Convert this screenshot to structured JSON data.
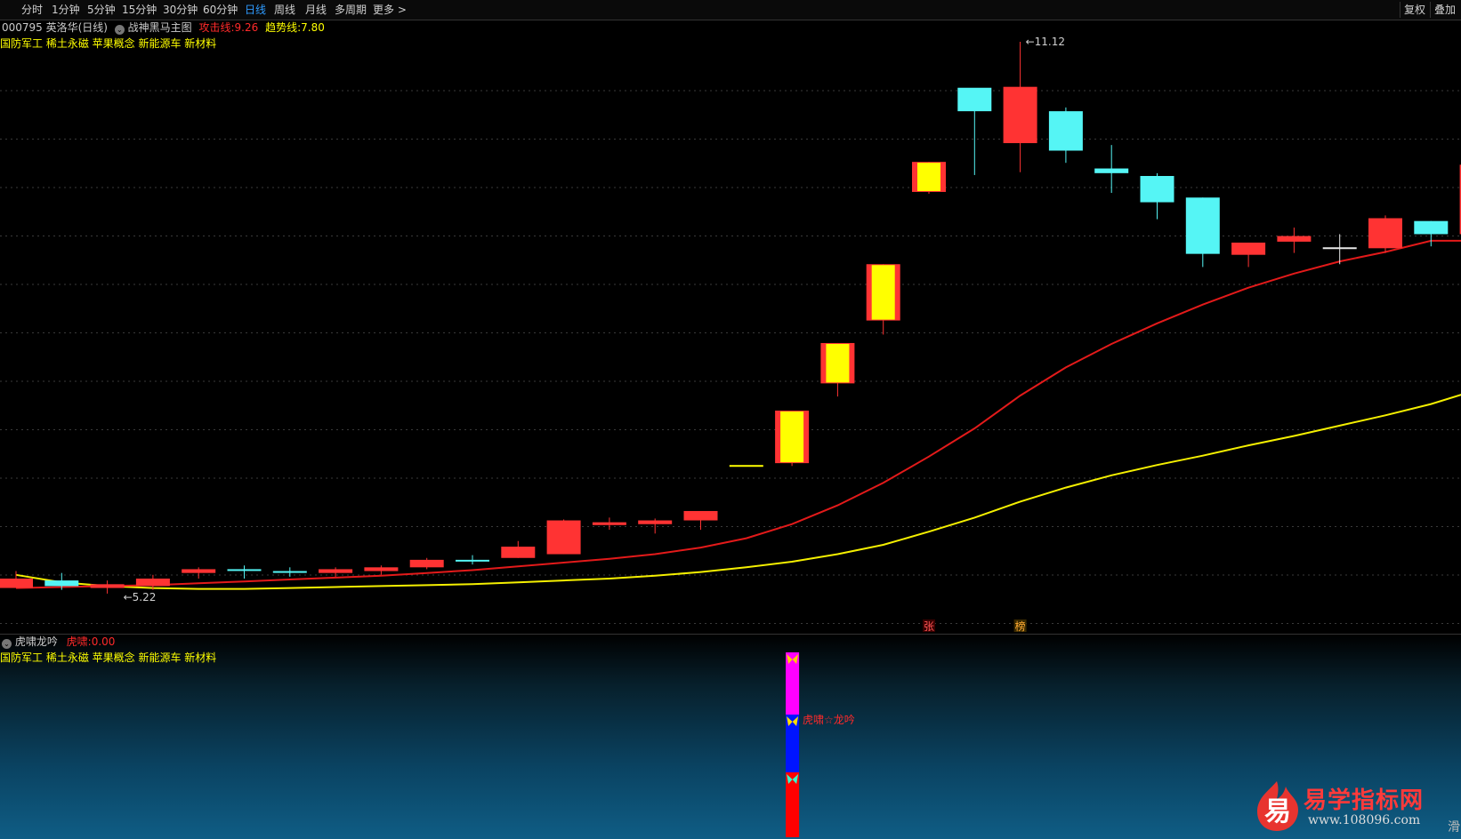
{
  "toolbar": {
    "timeframes": [
      "分时",
      "1分钟",
      "5分钟",
      "15分钟",
      "30分钟",
      "60分钟",
      "日线",
      "周线",
      "月线",
      "多周期",
      "更多 >"
    ],
    "active": "日线",
    "right": [
      "复权",
      "叠加"
    ]
  },
  "main_panel": {
    "stock_label": "000795 英洛华(日线)",
    "indicator_name": "战神黑马主图",
    "attack_label": "攻击线:",
    "attack_value": "9.26",
    "trend_label": "趋势线:",
    "trend_value": "7.80",
    "concepts": "国防军工 稀土永磁 苹果概念 新能源车 新材料",
    "high_label": "11.12",
    "low_label": "5.22",
    "marker_zhang": "张",
    "marker_bang": "榜"
  },
  "sub_panel": {
    "indicator_name": "虎啸龙吟",
    "value_label": "虎啸:",
    "value": "0.00",
    "concepts": "国防军工 稀土永磁 苹果概念 新能源车 新材料",
    "signal_text": "虎啸☆龙吟"
  },
  "watermark": {
    "logo_char": "易",
    "name": "易学指标网",
    "url": "www.108096.com",
    "edge_char": "滑"
  },
  "colors": {
    "up": "#ff3333",
    "down": "#55f5f5",
    "highlight": "#ffff00",
    "attack_line": "#e31a1a",
    "trend_line": "#f5f000",
    "active_tab": "#2e9bff"
  },
  "chart_data": {
    "type": "candlestick",
    "price_range": [
      5.0,
      11.4
    ],
    "high": 11.12,
    "low": 5.22,
    "candles": [
      {
        "o": 5.4,
        "h": 5.48,
        "l": 5.3,
        "c": 5.3,
        "style": "up"
      },
      {
        "o": 5.38,
        "h": 5.46,
        "l": 5.28,
        "c": 5.32,
        "style": "down"
      },
      {
        "o": 5.3,
        "h": 5.38,
        "l": 5.24,
        "c": 5.34,
        "style": "up"
      },
      {
        "o": 5.32,
        "h": 5.44,
        "l": 5.28,
        "c": 5.4,
        "style": "up"
      },
      {
        "o": 5.46,
        "h": 5.52,
        "l": 5.4,
        "c": 5.5,
        "style": "up"
      },
      {
        "o": 5.5,
        "h": 5.54,
        "l": 5.4,
        "c": 5.49,
        "style": "down"
      },
      {
        "o": 5.48,
        "h": 5.52,
        "l": 5.42,
        "c": 5.47,
        "style": "down"
      },
      {
        "o": 5.46,
        "h": 5.52,
        "l": 5.42,
        "c": 5.5,
        "style": "up"
      },
      {
        "o": 5.48,
        "h": 5.54,
        "l": 5.44,
        "c": 5.52,
        "style": "up"
      },
      {
        "o": 5.52,
        "h": 5.62,
        "l": 5.5,
        "c": 5.6,
        "style": "up"
      },
      {
        "o": 5.6,
        "h": 5.65,
        "l": 5.55,
        "c": 5.59,
        "style": "down"
      },
      {
        "o": 5.62,
        "h": 5.8,
        "l": 5.62,
        "c": 5.74,
        "style": "up"
      },
      {
        "o": 5.66,
        "h": 6.03,
        "l": 5.66,
        "c": 6.02,
        "style": "up"
      },
      {
        "o": 5.97,
        "h": 6.05,
        "l": 5.92,
        "c": 6.0,
        "style": "up"
      },
      {
        "o": 5.98,
        "h": 6.04,
        "l": 5.88,
        "c": 6.02,
        "style": "up"
      },
      {
        "o": 6.02,
        "h": 6.12,
        "l": 5.92,
        "c": 6.12,
        "style": "up"
      },
      {
        "o": 6.61,
        "h": 6.61,
        "l": 6.61,
        "c": 6.61,
        "style": "doji"
      },
      {
        "o": 6.63,
        "h": 7.19,
        "l": 6.6,
        "c": 7.19,
        "style": "limit"
      },
      {
        "o": 7.48,
        "h": 7.91,
        "l": 7.34,
        "c": 7.91,
        "style": "limit"
      },
      {
        "o": 8.15,
        "h": 8.75,
        "l": 8.0,
        "c": 8.75,
        "style": "limit"
      },
      {
        "o": 9.52,
        "h": 9.84,
        "l": 9.5,
        "c": 9.84,
        "style": "limit"
      },
      {
        "o": 10.38,
        "h": 10.6,
        "l": 9.7,
        "c": 10.63,
        "style": "down"
      },
      {
        "o": 10.04,
        "h": 11.12,
        "l": 9.73,
        "c": 10.64,
        "style": "up"
      },
      {
        "o": 9.96,
        "h": 10.42,
        "l": 9.83,
        "c": 10.38,
        "style": "down"
      },
      {
        "o": 9.72,
        "h": 10.02,
        "l": 9.51,
        "c": 9.77,
        "style": "down"
      },
      {
        "o": 9.41,
        "h": 9.72,
        "l": 9.23,
        "c": 9.69,
        "style": "down"
      },
      {
        "o": 8.86,
        "h": 9.46,
        "l": 8.72,
        "c": 9.46,
        "style": "down"
      },
      {
        "o": 8.85,
        "h": 8.98,
        "l": 8.72,
        "c": 8.98,
        "style": "up"
      },
      {
        "o": 8.99,
        "h": 9.14,
        "l": 8.87,
        "c": 9.05,
        "style": "up"
      },
      {
        "o": 8.93,
        "h": 9.07,
        "l": 8.75,
        "c": 8.93,
        "style": "doji"
      },
      {
        "o": 8.92,
        "h": 9.27,
        "l": 8.87,
        "c": 9.24,
        "style": "up"
      },
      {
        "o": 9.07,
        "h": 9.21,
        "l": 8.94,
        "c": 9.21,
        "style": "down"
      },
      {
        "o": 9.07,
        "h": 9.98,
        "l": 9.03,
        "c": 9.81,
        "style": "up"
      }
    ],
    "attack_line": [
      5.3,
      5.31,
      5.32,
      5.33,
      5.35,
      5.37,
      5.39,
      5.41,
      5.43,
      5.46,
      5.49,
      5.53,
      5.57,
      5.61,
      5.66,
      5.73,
      5.83,
      5.98,
      6.18,
      6.42,
      6.7,
      7.0,
      7.35,
      7.65,
      7.9,
      8.12,
      8.32,
      8.5,
      8.65,
      8.78,
      8.88,
      9.0,
      9.0,
      9.26
    ],
    "trend_line": [
      5.44,
      5.36,
      5.32,
      5.3,
      5.29,
      5.29,
      5.3,
      5.31,
      5.32,
      5.33,
      5.34,
      5.36,
      5.38,
      5.4,
      5.43,
      5.47,
      5.52,
      5.58,
      5.66,
      5.76,
      5.9,
      6.05,
      6.22,
      6.37,
      6.5,
      6.61,
      6.71,
      6.82,
      6.92,
      7.03,
      7.14,
      7.26,
      7.41,
      7.8
    ],
    "sub_signal": {
      "x_index": 17,
      "segments": [
        "magenta",
        "blue",
        "red"
      ]
    }
  }
}
